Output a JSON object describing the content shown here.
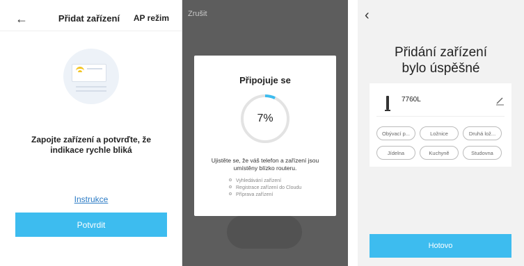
{
  "panel1": {
    "back_icon": "arrow-left-icon",
    "title": "Přidat zařízení",
    "ap_mode": "AP režim",
    "message": "Zapojte zařízení a potvrďte, že indikace rychle bliká",
    "instructions_link": "Instrukce",
    "confirm_button": "Potvrdit",
    "colors": {
      "accent": "#3dbcef",
      "link": "#2b7bc5",
      "led": "#f3c524"
    }
  },
  "panel2": {
    "cancel": "Zrušit",
    "dialog_title": "Připojuje se",
    "progress_percent": 7,
    "progress_label": "7%",
    "tip": "Ujistěte se, že váš telefon a zařízení jsou umístěny blízko routeru.",
    "steps": [
      "Vyhledávání zařízení",
      "Registrace zařízení do Cloudu",
      "Příprava zařízení"
    ],
    "colors": {
      "progress": "#3dbcef",
      "track": "#e3e3e3",
      "overlay": "#5d5d5d"
    }
  },
  "panel3": {
    "back_icon": "chevron-left-icon",
    "title_line1": "Přidání zařízení",
    "title_line2": "bylo úspěšné",
    "device_icon": "floor-lamp-icon",
    "device_name": "7760L",
    "edit_icon": "pencil-icon",
    "rooms": [
      "Obývací p...",
      "Ložnice",
      "Druhá lož...",
      "Jídelna",
      "Kuchyně",
      "Studovna"
    ],
    "done_button": "Hotovo",
    "colors": {
      "accent": "#3dbcef",
      "background": "#f2f2f2"
    }
  }
}
